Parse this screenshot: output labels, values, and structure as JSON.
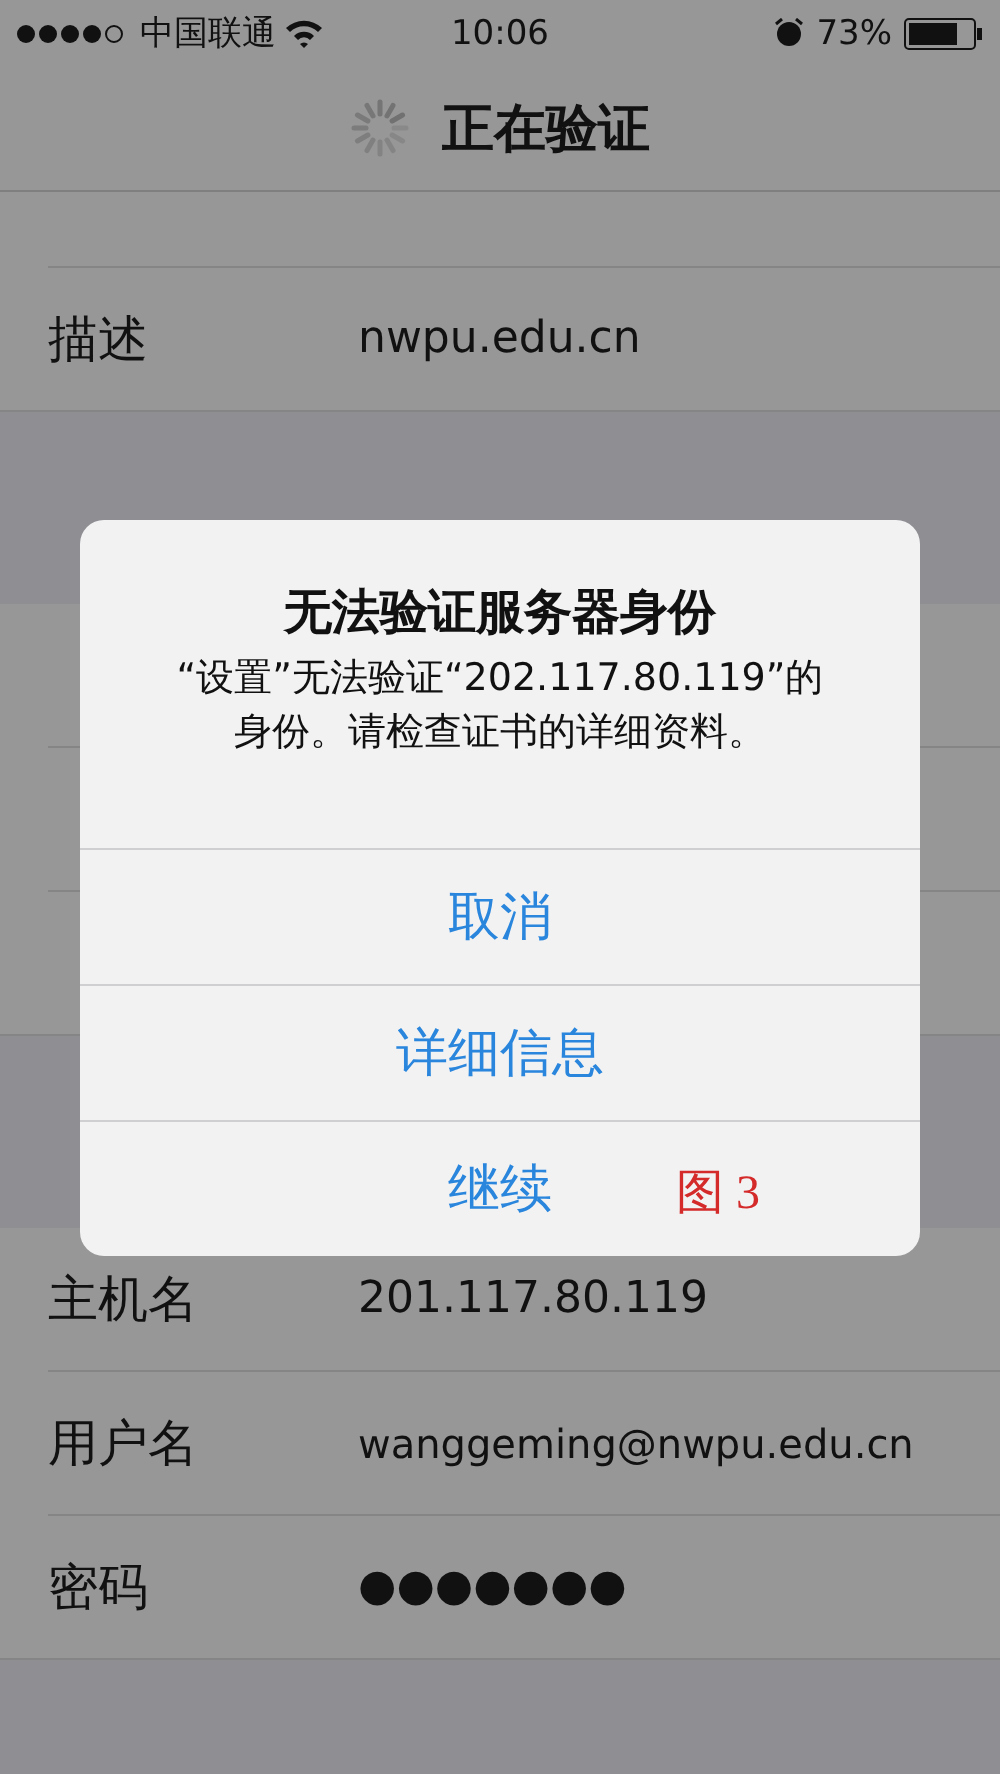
{
  "status_bar": {
    "carrier": "中国联通",
    "time": "10:06",
    "battery": "73%"
  },
  "nav_bar": {
    "title": "正在验证"
  },
  "account_rows": [
    {
      "label": "描述",
      "value": "nwpu.edu.cn"
    }
  ],
  "outgoing_rows": [
    {
      "label": "主机名",
      "value": "201.117.80.119"
    },
    {
      "label": "用户名",
      "value": "wanggeming@nwpu.edu.cn"
    },
    {
      "label": "密码",
      "value": "●●●●●●●"
    }
  ],
  "alert": {
    "title": "无法验证服务器身份",
    "message": "“设置”无法验证“202.117.80.119”的身份。请检查证书的详细资料。",
    "buttons": [
      "取消",
      "详细信息",
      "继续"
    ]
  },
  "figure_label": "图 3"
}
